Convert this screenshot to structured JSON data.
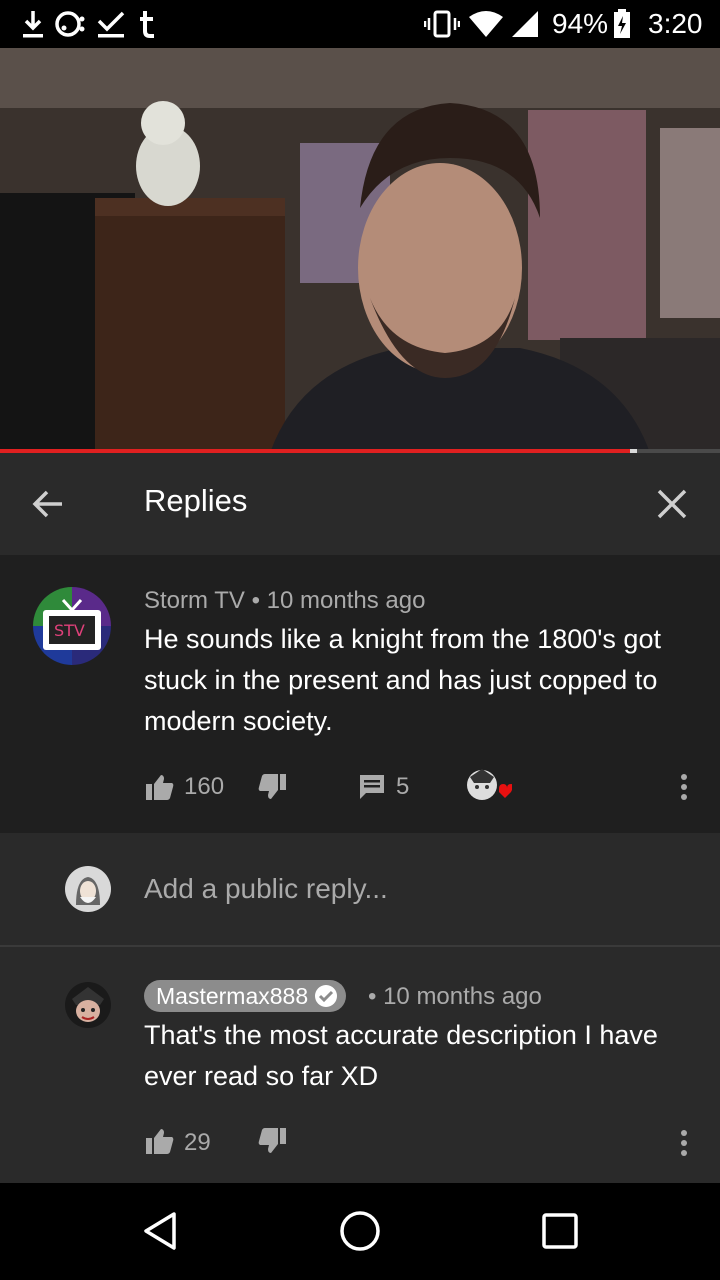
{
  "status_bar": {
    "battery": "94%",
    "time": "3:20",
    "left_icons": [
      "download-icon",
      "blocked-face-icon",
      "checkmark-icon",
      "tumblr-icon"
    ],
    "right_icons": [
      "vibrate-icon",
      "wifi-icon",
      "cell-signal-icon",
      "battery-charging-icon"
    ]
  },
  "video": {
    "progress_fraction": 0.875,
    "buffered_fraction": 0.01
  },
  "panel": {
    "title": "Replies"
  },
  "main_comment": {
    "author": "Storm TV",
    "separator": "•",
    "time": "10 months ago",
    "text": "He sounds like a knight from the 1800's got stuck in the present and has just copped to modern society.",
    "likes": "160",
    "replies": "5",
    "avatar_label": "STV"
  },
  "reply_input": {
    "placeholder": "Add a public reply..."
  },
  "reply": {
    "author": "Mastermax888",
    "separator": "•",
    "time": "10 months ago",
    "text": "That's the most accurate description I have ever read so far XD",
    "likes": "29"
  },
  "colors": {
    "accent_red": "#e02020",
    "panel_bg": "#2a2a2a",
    "comment_bg": "#1f1f1f",
    "muted_text": "#aaaaaa"
  }
}
